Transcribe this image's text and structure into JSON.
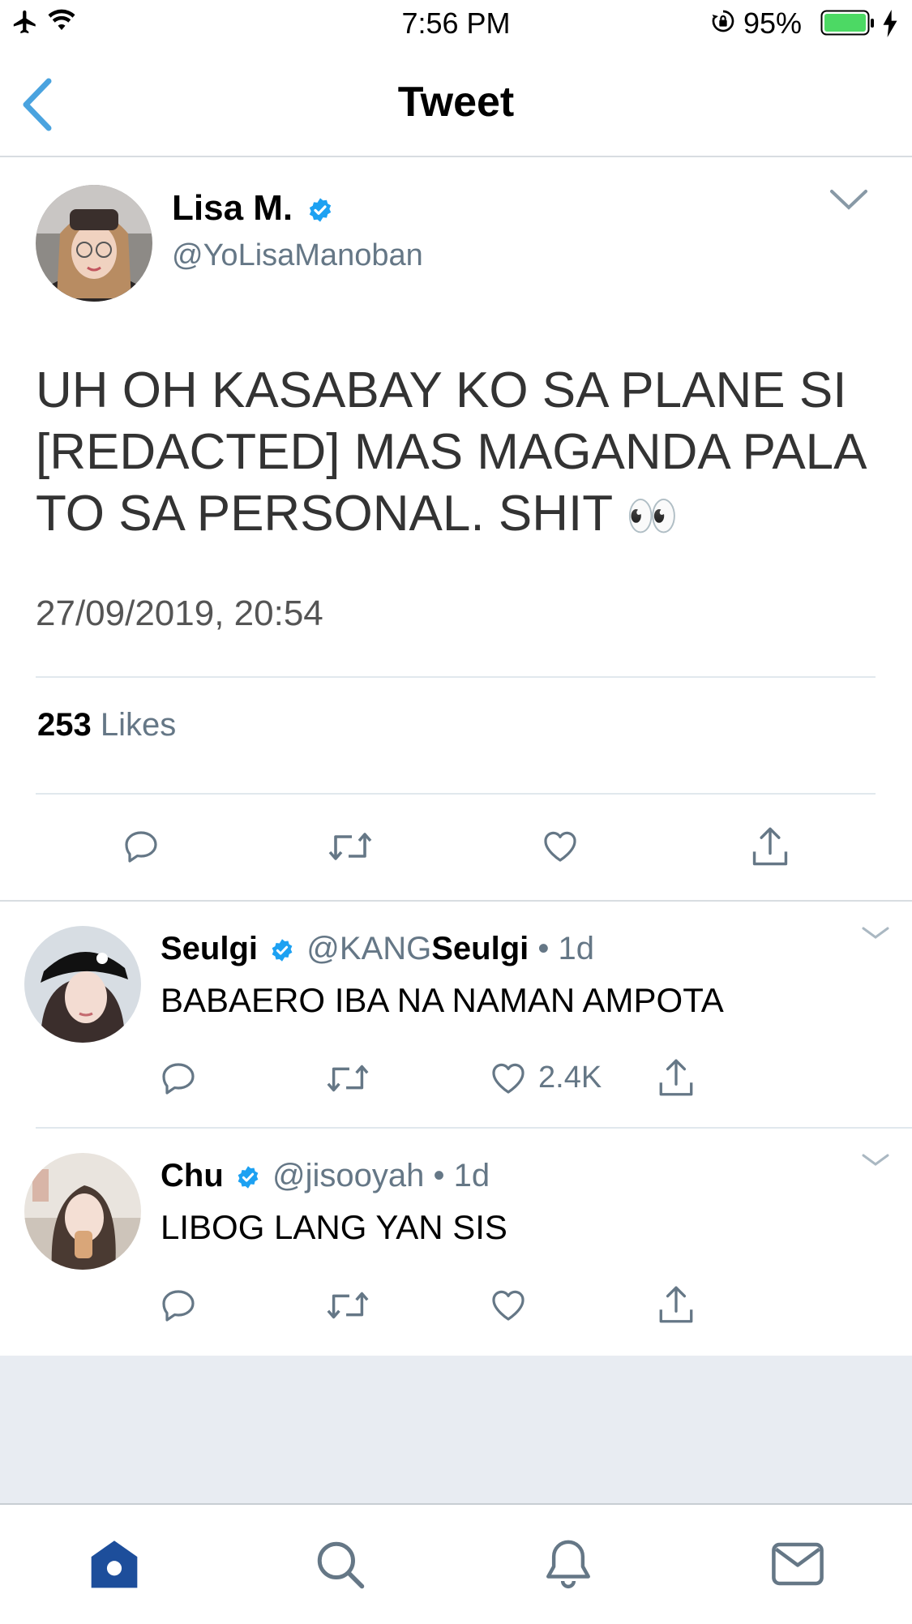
{
  "status_bar": {
    "time": "7:56 PM",
    "battery_percent": "95%"
  },
  "header": {
    "title": "Tweet"
  },
  "tweet": {
    "author_name": "Lisa M.",
    "author_handle": "@YoLisaManoban",
    "text_lines": [
      "UH OH KASABAY KO SA PLANE SI",
      "[REDACTED] MAS MAGANDA PALA",
      "TO SA PERSONAL. SHIT"
    ],
    "emoji": "👀",
    "timestamp": "27/09/2019, 20:54",
    "likes_count": "253",
    "likes_label": "Likes"
  },
  "replies": [
    {
      "name": "Seulgi",
      "handle_prefix": "@KANG",
      "handle_bold": "Seulgi",
      "age": "• 1d",
      "text": "BABAERO IBA NA NAMAN AMPOTA",
      "like_count": "2.4K"
    },
    {
      "name": "Chu",
      "handle_prefix": "@jisooyah",
      "handle_bold": "",
      "age": "• 1d",
      "text": "LIBOG LANG YAN SIS",
      "like_count": ""
    }
  ],
  "colors": {
    "accent": "#1da1f2",
    "back_arrow": "#4aa3df",
    "nav_active": "#1d4e9b",
    "battery": "#4cd964"
  },
  "icons": [
    "airplane-icon",
    "wifi-icon",
    "lock-rotation-icon",
    "battery-icon",
    "charging-icon",
    "back-chevron-icon",
    "chevron-down-icon",
    "verified-badge-icon",
    "reply-icon",
    "retweet-icon",
    "like-icon",
    "share-icon",
    "home-icon",
    "search-icon",
    "notifications-icon",
    "messages-icon"
  ]
}
